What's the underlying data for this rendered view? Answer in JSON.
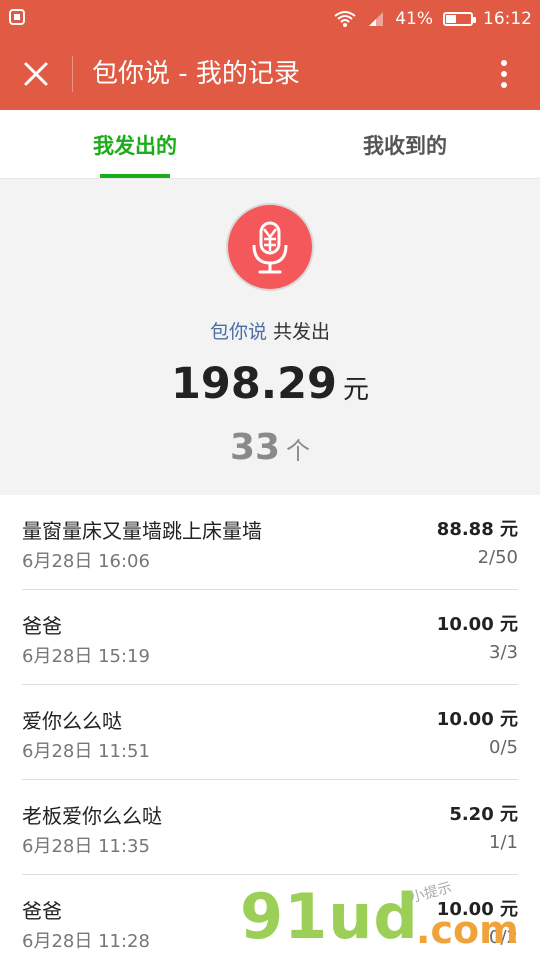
{
  "status_bar": {
    "battery_percent": "41%",
    "battery_level": 0.41,
    "time": "16:12"
  },
  "app_bar": {
    "title": "包你说 - 我的记录"
  },
  "tabs": [
    {
      "label": "我发出的",
      "active": true
    },
    {
      "label": "我收到的",
      "active": false
    }
  ],
  "summary": {
    "brand": "包你说",
    "sent_label": "共发出",
    "amount": "198.29",
    "amount_unit": "元",
    "count": "33",
    "count_unit": "个"
  },
  "records": [
    {
      "title": "量窗量床又量墙跳上床量墙",
      "time": "6月28日 16:06",
      "amount": "88.88 元",
      "progress": "2/50"
    },
    {
      "title": "爸爸",
      "time": "6月28日 15:19",
      "amount": "10.00 元",
      "progress": "3/3"
    },
    {
      "title": "爱你么么哒",
      "time": "6月28日 11:51",
      "amount": "10.00 元",
      "progress": "0/5"
    },
    {
      "title": "老板爱你么么哒",
      "time": "6月28日 11:35",
      "amount": "5.20 元",
      "progress": "1/1"
    },
    {
      "title": "爸爸",
      "time": "6月28日 11:28",
      "amount": "10.00 元",
      "progress": "0/2"
    }
  ],
  "watermark": {
    "text": "91ud",
    "dot": ".",
    "domain": "com",
    "small": "小提示"
  },
  "colors": {
    "header": "#e05a44",
    "active_tab": "#1aad19",
    "mic": "#f4585b",
    "brand_text": "#4a6fa5"
  }
}
